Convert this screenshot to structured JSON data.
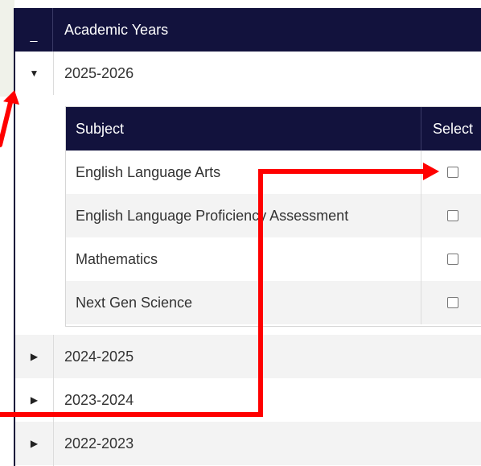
{
  "table": {
    "collapse_symbol": "_",
    "header_title": "Academic Years",
    "expanded_toggle": "▼",
    "collapsed_toggle": "▶",
    "years": [
      {
        "label": "2025-2026",
        "expanded": true
      },
      {
        "label": "2024-2025",
        "expanded": false
      },
      {
        "label": "2023-2024",
        "expanded": false
      },
      {
        "label": "2022-2023",
        "expanded": false
      }
    ]
  },
  "subjects": {
    "header_subject": "Subject",
    "header_select": "Select",
    "rows": [
      {
        "name": "English Language Arts",
        "checked": false
      },
      {
        "name": "English Language Proficiency Assessment",
        "checked": false
      },
      {
        "name": "Mathematics",
        "checked": false
      },
      {
        "name": "Next Gen Science",
        "checked": false
      }
    ]
  },
  "colors": {
    "header_bg": "#12123d",
    "row_alt": "#f3f3f3",
    "annotation": "#ff0000"
  }
}
